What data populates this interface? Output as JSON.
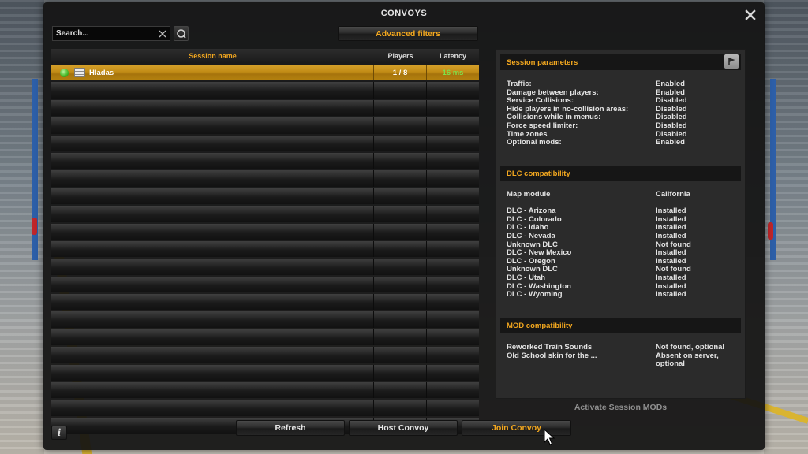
{
  "window": {
    "title": "CONVOYS"
  },
  "search": {
    "placeholder": "Search..."
  },
  "toolbar": {
    "advanced_filters": "Advanced filters"
  },
  "table": {
    "headers": {
      "name": "Session name",
      "players": "Players",
      "latency": "Latency"
    },
    "sessions": [
      {
        "name": "Hladas",
        "players": "1 / 8",
        "latency": "16 ms",
        "status": "online",
        "selected": true
      }
    ],
    "empty_rows": 20
  },
  "session_parameters": {
    "title": "Session parameters",
    "items": [
      {
        "label": "Traffic:",
        "value": "Enabled"
      },
      {
        "label": "Damage between players:",
        "value": "Enabled"
      },
      {
        "label": "Service Collisions:",
        "value": "Disabled"
      },
      {
        "label": "Hide players in no-collision areas:",
        "value": "Disabled"
      },
      {
        "label": "Collisions while in menus:",
        "value": "Disabled"
      },
      {
        "label": "Force speed limiter:",
        "value": "Disabled"
      },
      {
        "label": "Time zones",
        "value": "Disabled"
      },
      {
        "label": "Optional mods:",
        "value": "Enabled"
      }
    ]
  },
  "dlc_compatibility": {
    "title": "DLC compatibility",
    "map_module": {
      "label": "Map module",
      "value": "California"
    },
    "items": [
      {
        "label": "DLC - Arizona",
        "value": "Installed"
      },
      {
        "label": "DLC - Colorado",
        "value": "Installed"
      },
      {
        "label": "DLC - Idaho",
        "value": "Installed"
      },
      {
        "label": "DLC - Nevada",
        "value": "Installed"
      },
      {
        "label": "Unknown DLC",
        "value": "Not found"
      },
      {
        "label": "DLC - New Mexico",
        "value": "Installed"
      },
      {
        "label": "DLC - Oregon",
        "value": "Installed"
      },
      {
        "label": "Unknown DLC",
        "value": "Not found"
      },
      {
        "label": "DLC - Utah",
        "value": "Installed"
      },
      {
        "label": "DLC - Washington",
        "value": "Installed"
      },
      {
        "label": "DLC - Wyoming",
        "value": "Installed"
      }
    ]
  },
  "mod_compatibility": {
    "title": "MOD compatibility",
    "items": [
      {
        "label": "Reworked Train Sounds",
        "value": "Not found, optional"
      },
      {
        "label": "Old School skin for the ...",
        "value": "Absent on server, optional"
      }
    ]
  },
  "activate_mods": "Activate Session MODs",
  "buttons": {
    "refresh": "Refresh",
    "host": "Host Convoy",
    "join": "Join Convoy",
    "info": "i"
  },
  "colors": {
    "accent": "#f2a71f",
    "selected_row": "#c28c16",
    "latency_good": "#7ee04a",
    "panel_bg": "#2b2b2b"
  },
  "icons": {
    "close": "close-icon",
    "search": "search-icon",
    "clear": "clear-icon",
    "status": "status-online-icon",
    "server": "server-icon",
    "flag": "flag-icon",
    "info": "info-icon",
    "cursor": "mouse-cursor-icon"
  }
}
